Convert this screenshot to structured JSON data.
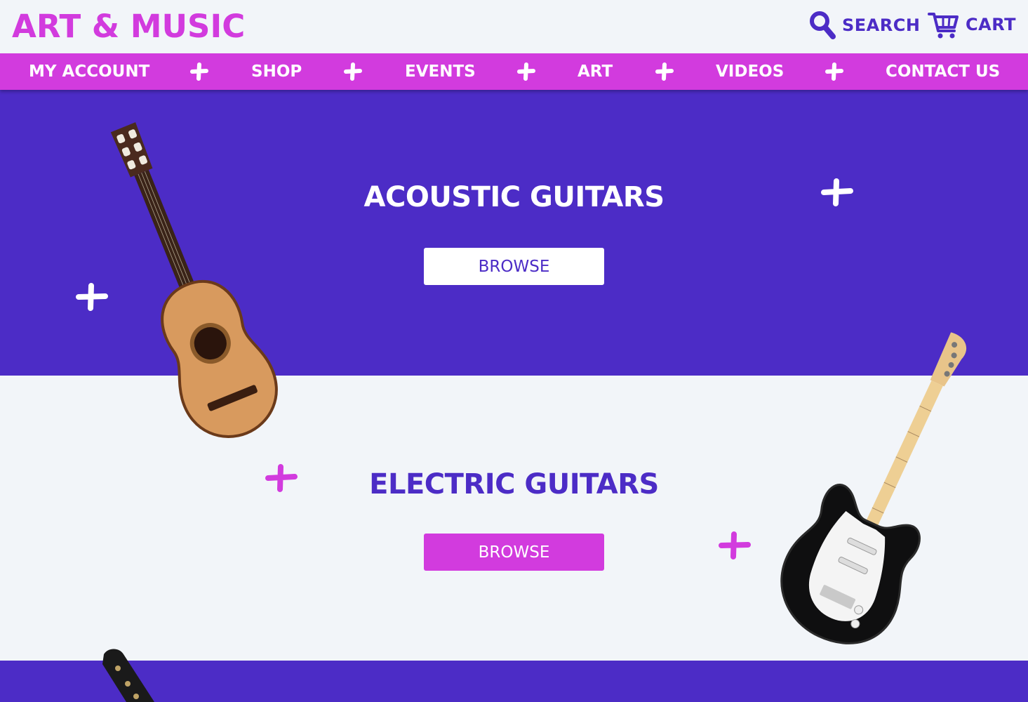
{
  "brand": {
    "logo": "ART & MUSIC"
  },
  "header": {
    "search_label": "SEARCH",
    "cart_label": "CART",
    "search_icon": "search-icon",
    "cart_icon": "cart-icon"
  },
  "nav": {
    "items": [
      {
        "label": "MY ACCOUNT"
      },
      {
        "label": "SHOP"
      },
      {
        "label": "EVENTS"
      },
      {
        "label": "ART"
      },
      {
        "label": "VIDEOS"
      },
      {
        "label": "CONTACT US"
      }
    ],
    "separator_icon": "plus-icon"
  },
  "sections": {
    "acoustic": {
      "title": "ACOUSTIC GUITARS",
      "button_label": "BROWSE"
    },
    "electric": {
      "title": "ELECTRIC GUITARS",
      "button_label": "BROWSE"
    }
  },
  "colors": {
    "brand_magenta": "#d23bde",
    "brand_purple": "#4c2cc6",
    "background_light": "#f2f5f9",
    "white": "#ffffff"
  }
}
